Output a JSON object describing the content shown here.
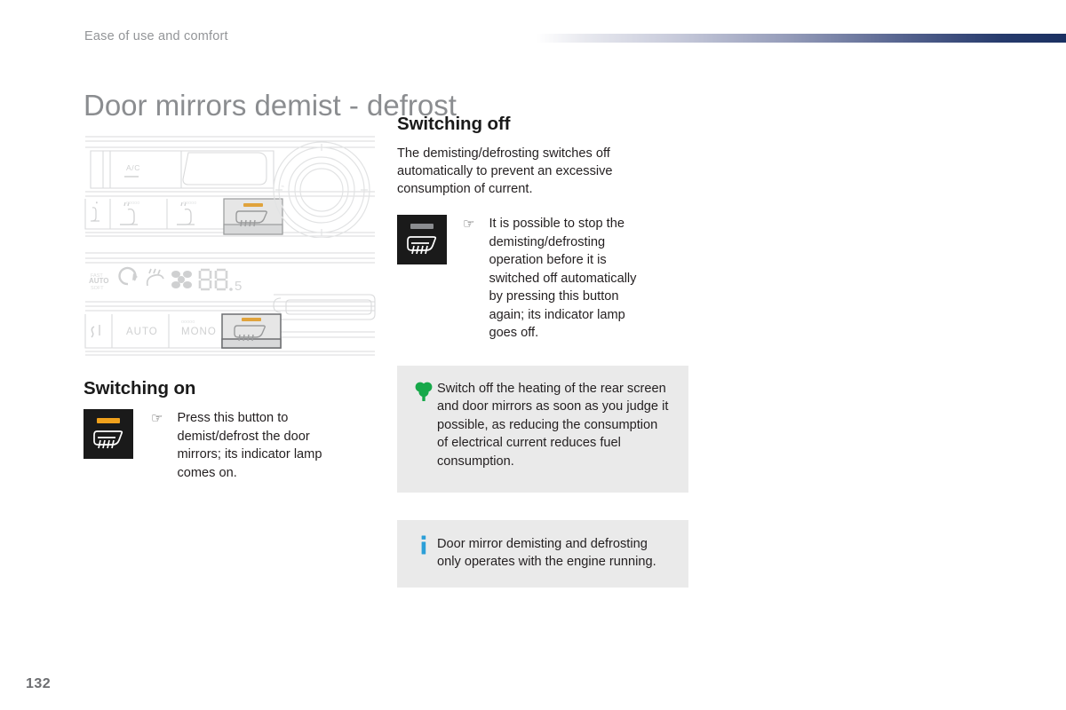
{
  "page": {
    "breadcrumb": "Ease of use and comfort",
    "title": "Door mirrors demist - defrost",
    "number": "132",
    "accent_dark": "#1a3061",
    "callout_bg": "#eaeaea",
    "lamp_on_color": "#f0a11c",
    "lamp_off_color": "#8b8d90",
    "eco_icon_color": "#17a84a",
    "info_icon_color": "#2b9fd8"
  },
  "left_column": {
    "illustration_1": {
      "name": "climate-control-panel-manual",
      "labels": [
        "A/C"
      ],
      "highlighted_button": "door-mirror-demist-button",
      "lamp_state": "on"
    },
    "illustration_2": {
      "name": "climate-control-panel-automatic",
      "display_value": "88.5",
      "display_mode_label": "FAST AUTO SOFT",
      "labels": [
        "AUTO",
        "MONO"
      ],
      "highlighted_button": "door-mirror-demist-button",
      "lamp_state": "on"
    },
    "switching_on": {
      "heading": "Switching on",
      "bullet_marker": "☞",
      "text": "Press this button to demist/defrost the door mirrors; its indicator lamp comes on.",
      "button_icon": {
        "name": "door-mirror-demist-button-lit",
        "lamp": "on"
      }
    }
  },
  "right_column": {
    "switching_off": {
      "heading": "Switching off",
      "intro": "The demisting/defrosting switches off automatically to prevent an excessive consumption of current.",
      "bullet_marker": "☞",
      "bullet_text": "It is possible to stop the demisting/defrosting operation before it is switched off automatically by pressing this button again; its indicator lamp goes off.",
      "button_icon": {
        "name": "door-mirror-demist-button-unlit",
        "lamp": "off"
      }
    },
    "eco_callout": {
      "icon": "tree-icon",
      "text": "Switch off the heating of the rear screen and door mirrors as soon as you judge it possible, as reducing the consumption of electrical current reduces fuel consumption."
    },
    "info_callout": {
      "icon": "info-icon",
      "text": "Door mirror demisting and defrosting only operates with the engine running."
    }
  }
}
